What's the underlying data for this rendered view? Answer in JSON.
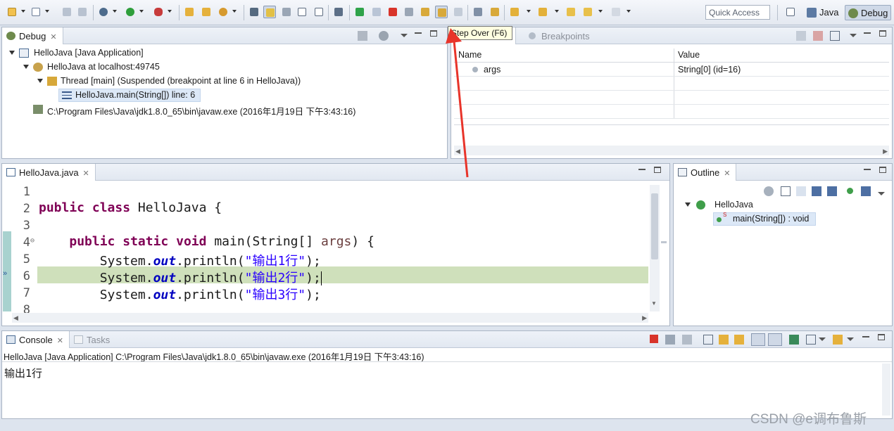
{
  "toolbar": {
    "quick_access_placeholder": "Quick Access",
    "perspective_java": "Java",
    "perspective_debug": "Debug",
    "tooltip": "Step Over (F6)"
  },
  "debug_view": {
    "tab_label": "Debug",
    "rows": [
      "HelloJava [Java Application]",
      "HelloJava at localhost:49745",
      "Thread [main] (Suspended (breakpoint at line 6 in HelloJava))",
      "HelloJava.main(String[]) line: 6",
      "C:\\Program Files\\Java\\jdk1.8.0_65\\bin\\javaw.exe (2016年1月19日 下午3:43:16)"
    ]
  },
  "variables_view": {
    "tab_breakpoints": "Breakpoints",
    "col_name": "Name",
    "col_value": "Value",
    "rows": [
      {
        "name": "args",
        "value": "String[0]  (id=16)"
      }
    ]
  },
  "editor": {
    "tab_label": "HelloJava.java",
    "lines": [
      {
        "num": "1"
      },
      {
        "num": "2",
        "kw1": "public",
        "kw2": "class",
        "rest": "HelloJava {"
      },
      {
        "num": "3"
      },
      {
        "num": "4",
        "kw1": "public",
        "kw2": "static",
        "kw3": "void",
        "pre": "main(String[] ",
        "param": "args",
        "post": ") {"
      },
      {
        "num": "5",
        "obj": "System.",
        "field": "out",
        "call": ".println(",
        "str": "\"输出1行\"",
        "end": ");"
      },
      {
        "num": "6",
        "obj": "System.",
        "field": "out",
        "call": ".println(",
        "str": "\"输出2行\"",
        "end": ");"
      },
      {
        "num": "7",
        "obj": "System.",
        "field": "out",
        "call": ".println(",
        "str": "\"输出3行\"",
        "end": ");"
      },
      {
        "num": "8"
      }
    ]
  },
  "outline_view": {
    "tab_label": "Outline",
    "class_name": "HelloJava",
    "method": "main(String[]) : void"
  },
  "console_view": {
    "tab_console": "Console",
    "tab_tasks": "Tasks",
    "process_line": "HelloJava [Java Application] C:\\Program Files\\Java\\jdk1.8.0_65\\bin\\javaw.exe (2016年1月19日 下午3:43:16)",
    "output": "输出1行"
  },
  "watermark": "CSDN @e调布鲁斯",
  "colors": {
    "current_line": "#cfe0bb",
    "keyword": "#7f0055",
    "string": "#2a00ff",
    "arrow": "#e8342a"
  }
}
